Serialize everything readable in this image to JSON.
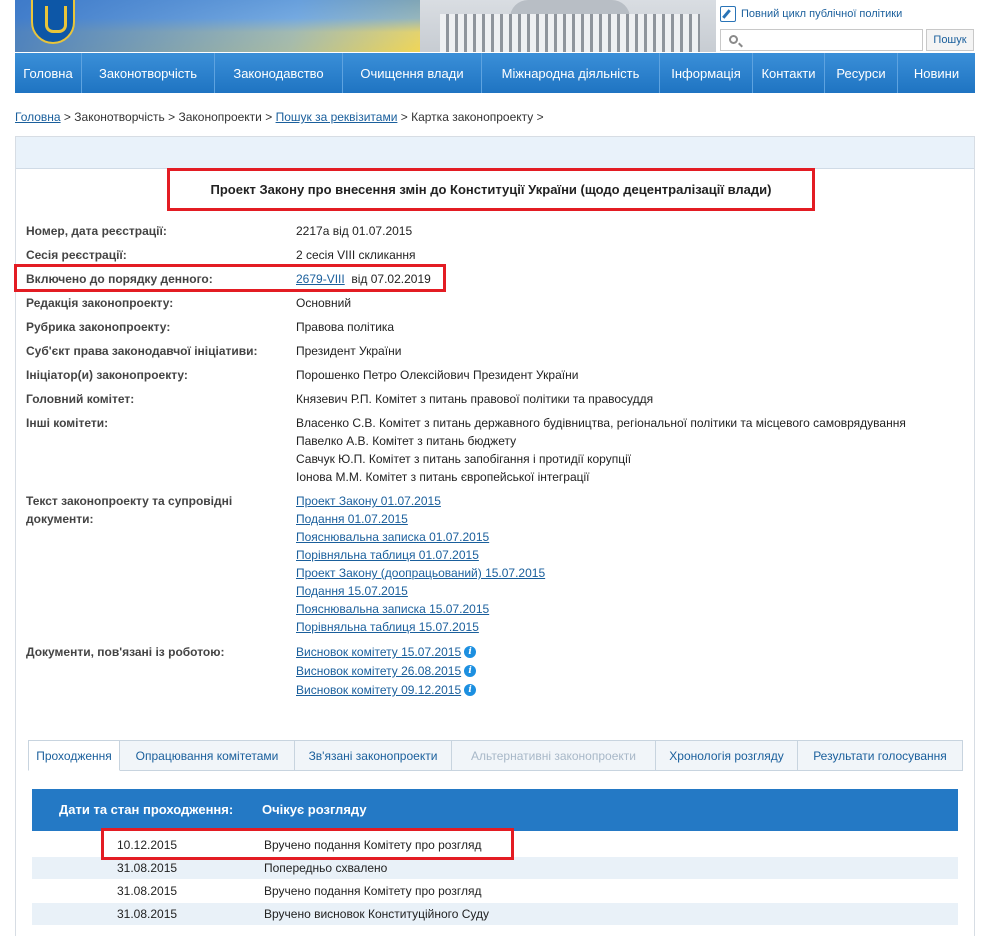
{
  "header": {
    "cycle_link": "Повний цикл публічної політики",
    "search_placeholder": "",
    "search_button": "Пошук"
  },
  "nav": [
    {
      "label": "Головна"
    },
    {
      "label": "Законотворчість"
    },
    {
      "label": "Законодавство"
    },
    {
      "label": "Очищення влади"
    },
    {
      "label": "Міжнародна діяльність"
    },
    {
      "label": "Інформація"
    },
    {
      "label": "Контакти"
    },
    {
      "label": "Ресурси"
    },
    {
      "label": "Новини"
    }
  ],
  "breadcrumb": {
    "home": "Головна",
    "sep": " > ",
    "b2": "Законотворчість",
    "b3": "Законопроекти",
    "b4": "Пошук за реквізитами",
    "b5": "Картка законопроекту",
    "tail": " >"
  },
  "bill": {
    "title": "Проект Закону про внесення змін до Конституції України (щодо децентралізації влади)",
    "fields": [
      {
        "label": "Номер, дата реєстрації:",
        "value": "2217а від 01.07.2015"
      },
      {
        "label": "Сесія реєстрації:",
        "value": "2 сесія VIII скликання"
      },
      {
        "label": "Включено до порядку денного:",
        "link": "2679-VIII",
        "value": "від 07.02.2019"
      },
      {
        "label": "Редакція законопроекту:",
        "value": "Основний"
      },
      {
        "label": "Рубрика законопроекту:",
        "value": "Правова політика"
      },
      {
        "label": "Суб'єкт права законодавчої ініціативи:",
        "value": "Президент України"
      },
      {
        "label": "Ініціатор(и) законопроекту:",
        "value": "Порошенко Петро Олексійович Президент України"
      },
      {
        "label": "Головний комітет:",
        "value": "Князевич Р.П. Комітет з питань правової політики та правосуддя"
      },
      {
        "label": "Інші комітети:"
      }
    ],
    "other_committees": [
      "Власенко С.В. Комітет з питань державного будівництва, регіональної політики та місцевого самоврядування",
      "Павелко А.В. Комітет з питань бюджету",
      "Савчук Ю.П. Комітет з питань запобігання і протидії корупції",
      "Іонова М.М. Комітет з питань європейської інтеграції"
    ],
    "docs_label_1": "Текст законопроекту та супровідні",
    "docs_label_2": "документи:",
    "docs": [
      "Проект Закону 01.07.2015",
      "Подання 01.07.2015",
      "Пояснювальна записка 01.07.2015",
      "Порівняльна таблиця 01.07.2015",
      "Проект Закону (доопрацьований) 15.07.2015",
      "Подання 15.07.2015",
      "Пояснювальна записка 15.07.2015",
      "Порівняльна таблиця 15.07.2015"
    ],
    "related_label": "Документи, пов'язані із роботою:",
    "related": [
      "Висновок комітету 15.07.2015",
      "Висновок комітету 26.08.2015",
      "Висновок комітету 09.12.2015"
    ]
  },
  "tabs": [
    {
      "label": "Проходження",
      "state": "active"
    },
    {
      "label": "Опрацювання комітетами",
      "state": "normal"
    },
    {
      "label": "Зв'язані законопроекти",
      "state": "normal"
    },
    {
      "label": "Альтернативні законопроекти",
      "state": "disabled"
    },
    {
      "label": "Хронологія розгляду",
      "state": "normal"
    },
    {
      "label": "Результати голосування",
      "state": "normal"
    }
  ],
  "progress": {
    "col1": "Дати та стан проходження:",
    "col2": "Очікує розгляду",
    "rows": [
      {
        "date": "10.12.2015",
        "text": "Вручено подання Комітету про розгляд"
      },
      {
        "date": "31.08.2015",
        "text": "Попередньо схвалено"
      },
      {
        "date": "31.08.2015",
        "text": "Вручено подання Комітету про розгляд"
      },
      {
        "date": "31.08.2015",
        "text": "Вручено висновок Конституційного Суду"
      }
    ]
  },
  "colors": {
    "nav": "#1f74c2",
    "link": "#1a5f9c",
    "highlight": "#e31c23",
    "table_head": "#2479c5"
  }
}
